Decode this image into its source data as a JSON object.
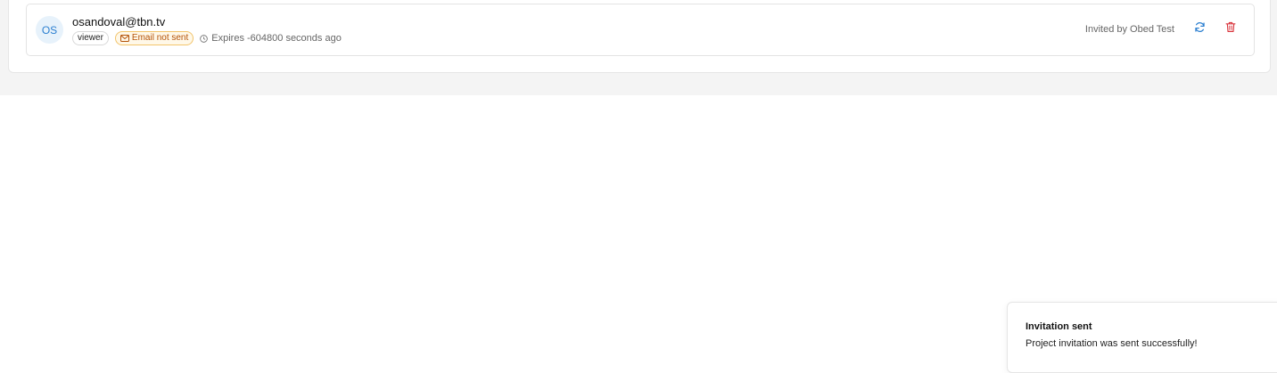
{
  "invitation": {
    "avatar_initials": "OS",
    "email": "osandoval@tbn.tv",
    "role": "viewer",
    "email_status": "Email not sent",
    "expires": "Expires -604800 seconds ago",
    "invited_by": "Invited by Obed Test"
  },
  "icons": {
    "email_status": "mail-icon",
    "expires": "clock-icon",
    "resend": "refresh-icon",
    "delete": "trash-icon"
  },
  "colors": {
    "accent": "#2b7fd0",
    "warning_text": "#b45309",
    "warning_border": "#f2c46b",
    "danger": "#d9363e"
  },
  "toast": {
    "title": "Invitation sent",
    "message": "Project invitation was sent successfully!"
  }
}
